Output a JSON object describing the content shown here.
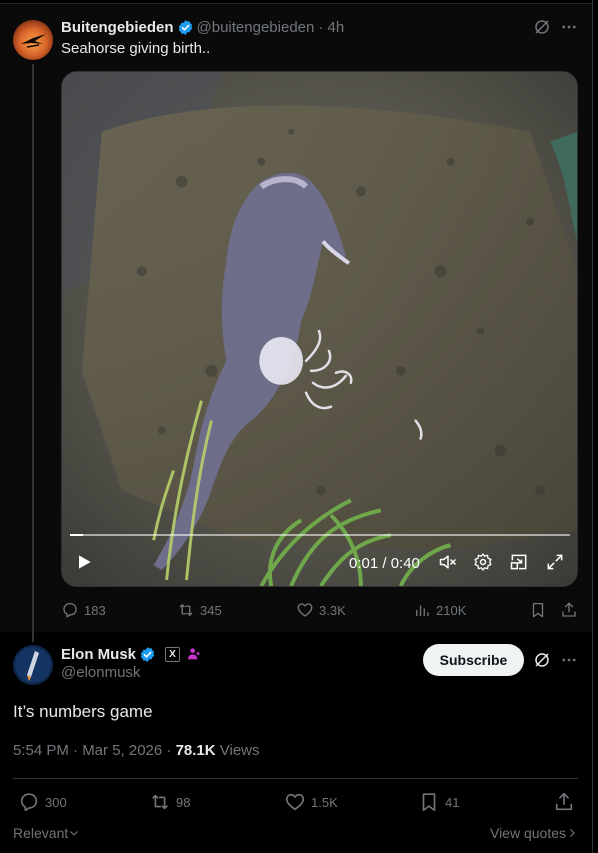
{
  "parent_tweet": {
    "author_name": "Buitengebieden",
    "author_handle": "@buitengebieden",
    "time": "· 4h",
    "text": "Seahorse giving birth..",
    "video": {
      "time_display": "0:01 / 0:40",
      "progress": 0.025
    },
    "stats": {
      "replies": "183",
      "reposts": "345",
      "likes": "3.3K",
      "views": "210K"
    }
  },
  "main_tweet": {
    "author_name": "Elon Musk",
    "author_handle": "@elonmusk",
    "x_badge": "X",
    "subscribe_label": "Subscribe",
    "text": "It’s numbers game",
    "timestamp": "5:54 PM · Mar 5, 2026 · ",
    "views_count": "78.1K",
    "views_label": " Views",
    "stats": {
      "replies": "300",
      "reposts": "98",
      "likes": "1.5K",
      "bookmarks": "41"
    }
  },
  "footer": {
    "sort_label": "Relevant",
    "view_quotes_label": "View quotes"
  },
  "colors": {
    "verified_blue": "#1d9bf0",
    "affiliate_pink": "#c936cc",
    "muted_text": "#71767b",
    "primary_text": "#e7e9ea"
  }
}
